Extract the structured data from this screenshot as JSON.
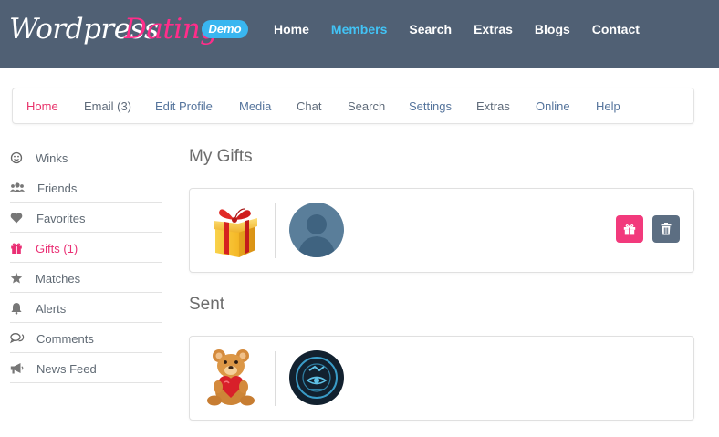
{
  "header": {
    "logo_part1": "Wordpress",
    "logo_part2": "Dating",
    "demo_badge": "Demo",
    "nav": [
      "Home",
      "Members",
      "Search",
      "Extras",
      "Blogs",
      "Contact"
    ],
    "active_nav": "Members"
  },
  "subnav": {
    "items": [
      "Home",
      "Email (3)",
      "Edit Profile",
      "Media",
      "Chat",
      "Search",
      "Settings",
      "Extras",
      "Online",
      "Help"
    ],
    "active": "Home"
  },
  "sidebar": {
    "items": [
      {
        "label": "Winks",
        "icon": "smile-icon"
      },
      {
        "label": "Friends",
        "icon": "users-icon"
      },
      {
        "label": "Favorites",
        "icon": "heart-icon"
      },
      {
        "label": "Gifts (1)",
        "icon": "gift-icon"
      },
      {
        "label": "Matches",
        "icon": "star-icon"
      },
      {
        "label": "Alerts",
        "icon": "bell-icon"
      },
      {
        "label": "Comments",
        "icon": "comments-icon"
      },
      {
        "label": "News Feed",
        "icon": "bullhorn-icon"
      }
    ],
    "active": "Gifts (1)"
  },
  "main": {
    "my_gifts_title": "My Gifts",
    "sent_title": "Sent"
  },
  "colors": {
    "header_bg": "#506074",
    "accent_pink": "#f23a7c",
    "accent_blue": "#42c3f5",
    "link_blue": "#55749c",
    "trash_button": "#5c6e82"
  }
}
